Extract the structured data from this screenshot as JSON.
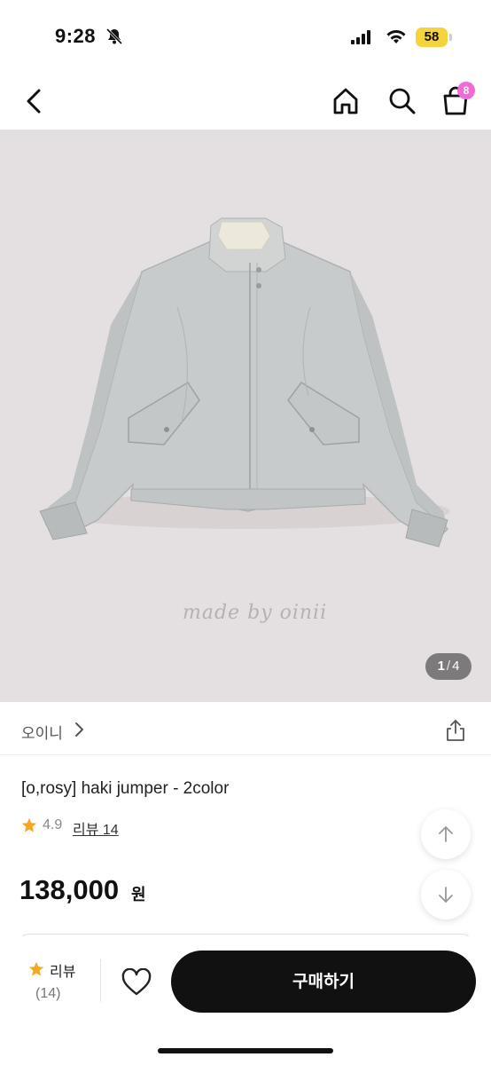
{
  "status": {
    "time": "9:28",
    "battery": "58"
  },
  "nav": {
    "cart_count": "8"
  },
  "hero": {
    "watermark": "made by oinii",
    "counter_current": "1",
    "counter_sep": "/",
    "counter_total": "4"
  },
  "brand": {
    "name": "오이니"
  },
  "product": {
    "title": "[o,rosy] haki jumper - 2color",
    "rating": "4.9",
    "reviews_label": "리뷰 14",
    "price": "138,000",
    "price_unit": "원"
  },
  "bottom": {
    "review_label": "리뷰",
    "review_count": "(14)",
    "buy_label": "구매하기"
  },
  "colors": {
    "accent_star": "#f5a623",
    "buy_button": "#111111",
    "badge": "#f06bd6"
  },
  "icons": [
    "back-arrow-icon",
    "home-icon",
    "search-icon",
    "cart-icon",
    "share-icon",
    "star-icon",
    "heart-icon",
    "arrow-up-icon",
    "arrow-down-icon"
  ]
}
